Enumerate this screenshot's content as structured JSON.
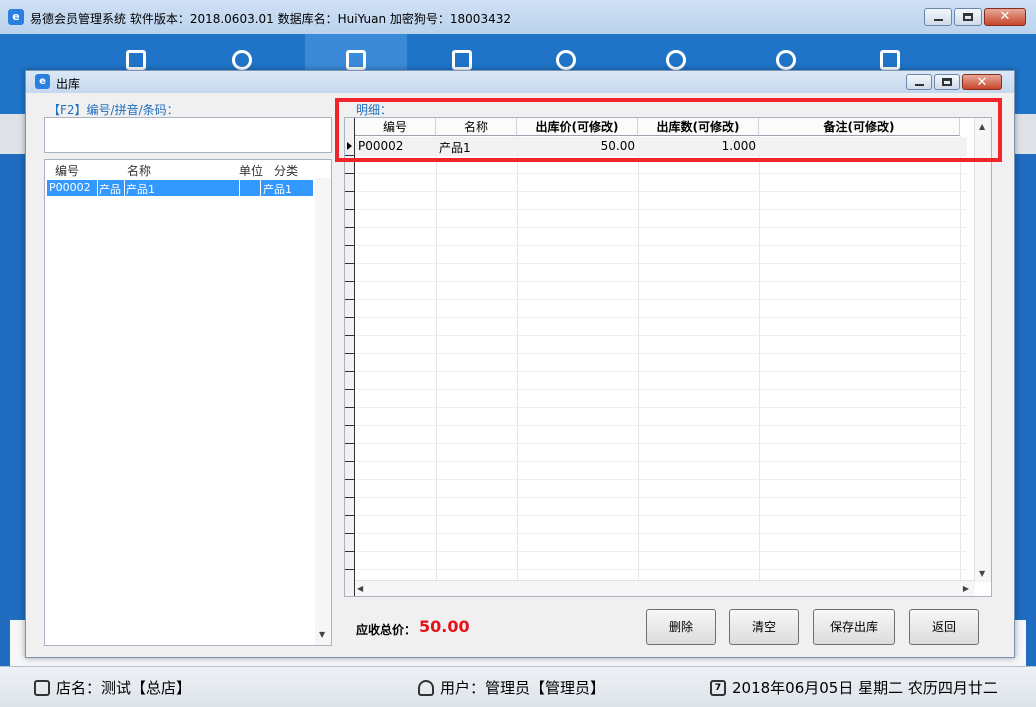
{
  "app": {
    "title": "易德会员管理系统   软件版本：2018.0603.01   数据库名：HuiYuan   加密狗号：18003432",
    "icon": "app-logo-icon"
  },
  "nav": {
    "icons": [
      "clipboard-icon",
      "users-icon",
      "box-icon",
      "tag-icon",
      "refresh-icon",
      "pie-chart-icon",
      "gear-icon",
      "export-icon"
    ]
  },
  "dialog": {
    "title": "出库",
    "search_label": "【F2】编号/拼音/条码：",
    "search_value": "",
    "detail_label": "明细："
  },
  "product_list": {
    "columns": [
      "编号",
      "名称",
      "单位",
      "分类"
    ],
    "rows": [
      {
        "code": "P00002",
        "name_a": "产品",
        "name_b": "产品1",
        "unit": "",
        "category": "产品1"
      }
    ]
  },
  "detail_grid": {
    "columns": [
      "编号",
      "名称",
      "出库价(可修改)",
      "出库数(可修改)",
      "备注(可修改)"
    ],
    "rows": [
      {
        "code": "P00002",
        "name": "产品1",
        "price": "50.00",
        "qty": "1.000",
        "note": ""
      }
    ]
  },
  "summary": {
    "total_label": "应收总价：",
    "total_value": "50.00"
  },
  "buttons": {
    "delete": "删除",
    "clear": "清空",
    "save_out": "保存出库",
    "back": "返回"
  },
  "status": {
    "store": "店名：测试【总店】",
    "user": "用户：管理员【管理员】",
    "date": "2018年06月05日 星期二 农历四月廿二"
  },
  "colors": {
    "highlight": "#f0242a",
    "total_value": "#e5121a",
    "selection": "#3399ff",
    "nav_band": "#1f74c8",
    "label_blue": "#1f6fc0"
  }
}
